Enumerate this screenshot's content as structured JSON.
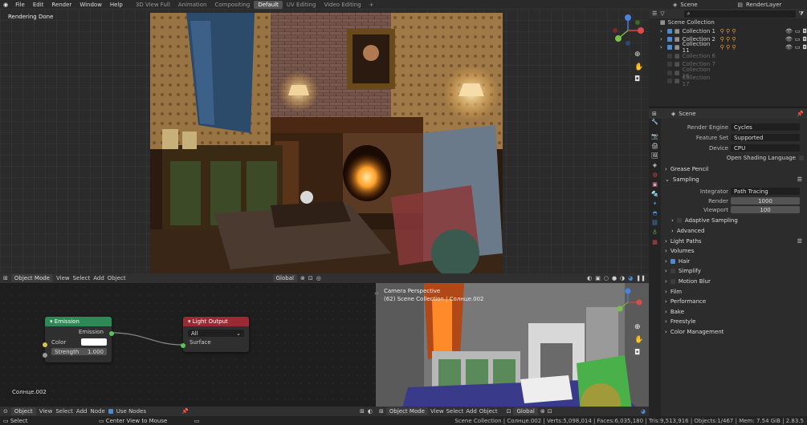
{
  "topbar": {
    "menus": [
      "File",
      "Edit",
      "Render",
      "Window",
      "Help"
    ],
    "workspaces": [
      "3D View Full",
      "Animation",
      "Compositing",
      "Default",
      "UV Editing",
      "Video Editing"
    ],
    "add": "+",
    "scene": "Scene",
    "render_layer": "RenderLayer"
  },
  "viewport": {
    "status": "Rendering Done"
  },
  "view3d_header": {
    "mode": "Object Mode",
    "menus": [
      "View",
      "Select",
      "Add",
      "Object"
    ],
    "transform": "Global"
  },
  "outliner": {
    "root": "Scene Collection",
    "items": [
      {
        "name": "Collection 1",
        "active": true
      },
      {
        "name": "Collection 2",
        "active": true
      },
      {
        "name": "Collection 11",
        "active": true
      },
      {
        "name": "Collection 6",
        "active": false
      },
      {
        "name": "Collection 7",
        "active": false
      },
      {
        "name": "Collection 16",
        "active": false
      },
      {
        "name": "Collection 17",
        "active": false
      }
    ]
  },
  "properties": {
    "title": "Scene",
    "render_engine_label": "Render Engine",
    "render_engine": "Cycles",
    "feature_set_label": "Feature Set",
    "feature_set": "Supported",
    "device_label": "Device",
    "device": "CPU",
    "osl": "Open Shading Language",
    "grease_pencil": "Grease Pencil",
    "sampling": "Sampling",
    "integrator_label": "Integrator",
    "integrator": "Path Tracing",
    "render_label": "Render",
    "render_samples": "1000",
    "viewport_label": "Viewport",
    "viewport_samples": "100",
    "adaptive": "Adaptive Sampling",
    "advanced": "Advanced",
    "sections": [
      "Light Paths",
      "Volumes",
      "Hair",
      "Simplify",
      "Motion Blur",
      "Film",
      "Performance",
      "Bake",
      "Freestyle",
      "Color Management"
    ]
  },
  "node_editor": {
    "emission_title": "Emission",
    "emission_out": "Emission",
    "color_label": "Color",
    "strength_label": "Strength",
    "strength_value": "1.000",
    "light_output_title": "Light Output",
    "target": "All",
    "surface": "Surface",
    "object_name": "Солнце.002",
    "header_mode": "Object",
    "header_menus": [
      "View",
      "Select",
      "Add",
      "Node"
    ],
    "use_nodes": "Use Nodes"
  },
  "view3d_small": {
    "title": "Camera Perspective",
    "subtitle": "(62) Scene Collection | Солнце.002",
    "mode": "Object Mode",
    "menus": [
      "View",
      "Select",
      "Add",
      "Object"
    ],
    "transform": "Global"
  },
  "statusbar": {
    "select": "Select",
    "center": "Center View to Mouse",
    "stats": "Scene Collection | Солнце.002 | Verts:5,098,014 | Faces:6,035,180 | Tris:9,513,916 | Objects:1/467 | Mem: 7.54 GiB | 2.83.5"
  },
  "colors": {
    "emission_header": "#2d8a56",
    "output_header": "#9b2a35",
    "accent": "#4d8ad0"
  }
}
